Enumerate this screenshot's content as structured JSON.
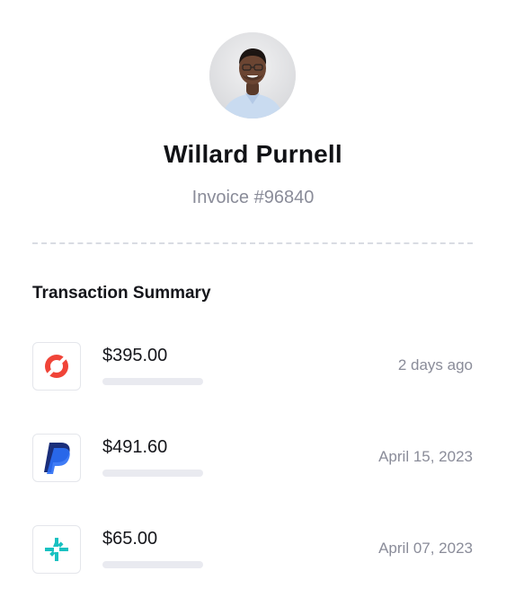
{
  "profile": {
    "name": "Willard Purnell",
    "invoice": "Invoice #96840",
    "avatar_icon": "person-avatar"
  },
  "summary": {
    "title": "Transaction Summary"
  },
  "transactions": [
    {
      "icon": "red-ring-logo-icon",
      "amount": "$395.00",
      "date": "2 days ago",
      "accent": "#f04438"
    },
    {
      "icon": "paypal-logo-icon",
      "amount": "$491.60",
      "date": "April 15, 2023",
      "accent": "#1a3bb0"
    },
    {
      "icon": "teal-pinwheel-logo-icon",
      "amount": "$65.00",
      "date": "April 07, 2023",
      "accent": "#19c1c1"
    }
  ]
}
